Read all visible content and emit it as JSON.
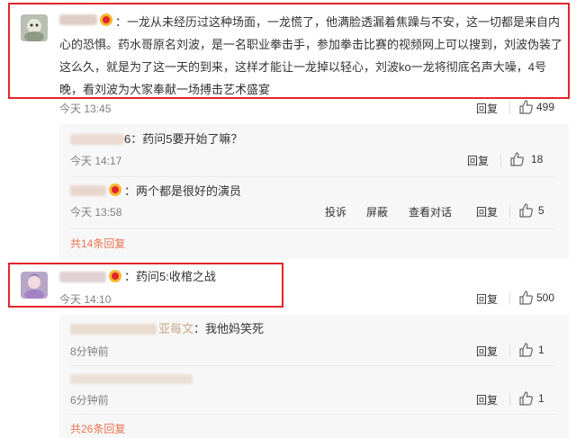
{
  "comments": [
    {
      "text_lines": [
        "：一龙从未经历过这种场面，一龙慌了，他满脸透漏着焦躁与不安，这一切都是来自内",
        "心的恐惧。药水哥原名刘波，是一名职业拳击手，参加拳击比赛的视频网上可以搜到，刘波伪装了",
        "这么久，就是为了这一天的到来，这样才能让一龙掉以轻心，刘波ko一龙将彻底名声大噪，4号",
        "晚，看刘波为大家奉献一场搏击艺术盛宴"
      ],
      "time": "今天 13:45",
      "reply": "回复",
      "likes": "499",
      "replies": [
        {
          "name_suffix": "6",
          "text": "：药问5要开始了嘛？",
          "time": "今天 14:17",
          "reply": "回复",
          "likes": "18"
        },
        {
          "text": "：两个都是很好的演员",
          "time": "今天 13:58",
          "report": "投诉",
          "block": "屏蔽",
          "dialog": "查看对话",
          "reply": "回复",
          "likes": "5"
        }
      ],
      "more": "共14条回复"
    },
    {
      "text": "：药问5:收棺之战",
      "time": "今天 14:10",
      "reply": "回复",
      "likes": "500",
      "replies": [
        {
          "name_suffix": "亚每文",
          "text": "：我他妈笑死",
          "time": "8分钟前",
          "reply": "回复",
          "likes": "1"
        },
        {
          "time": "6分钟前",
          "reply": "回复",
          "likes": "1"
        }
      ],
      "more": "共26条回复"
    }
  ],
  "colors": {
    "highlight_border": "#e2262b",
    "more_link": "#eb7350",
    "time": "#808080",
    "sub_bg": "#f7f7f7"
  }
}
